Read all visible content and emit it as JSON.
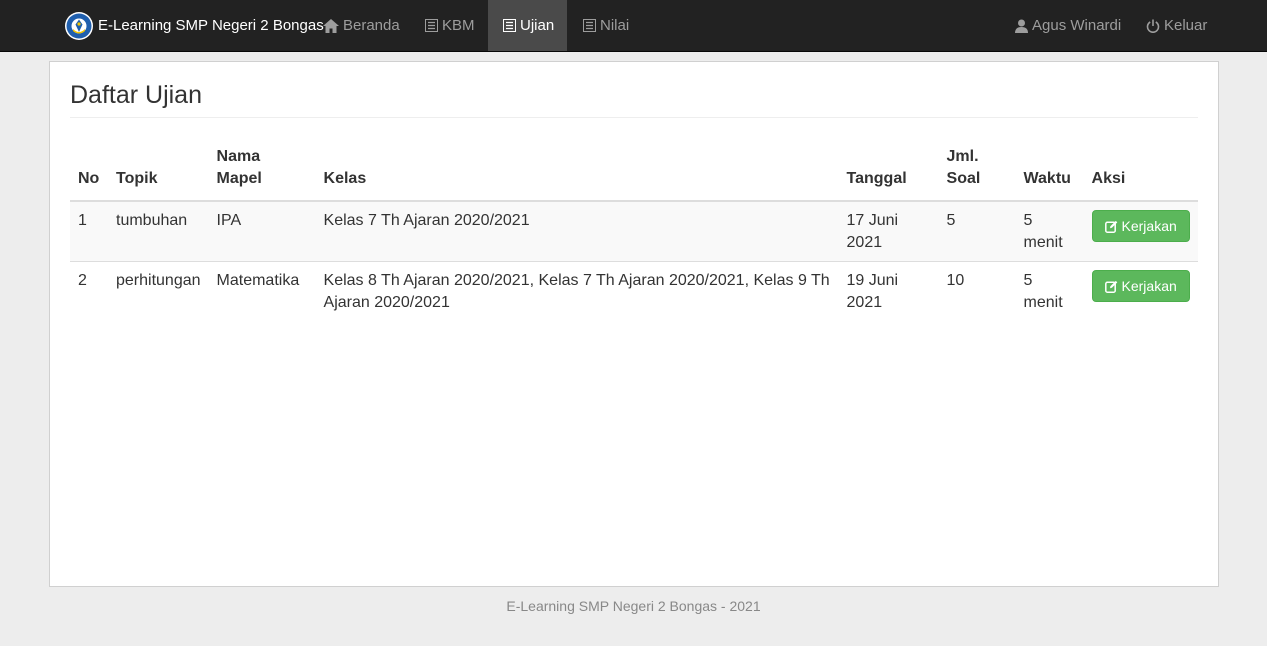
{
  "navbar": {
    "brand": "E-Learning SMP Negeri 2 Bongas",
    "brand_logo_icon": "tut-wuri-handayani-logo",
    "items": [
      {
        "label": "Beranda",
        "icon": "home-icon"
      },
      {
        "label": "KBM",
        "icon": "list-icon"
      },
      {
        "label": "Ujian",
        "icon": "list-icon",
        "active": true
      },
      {
        "label": "Nilai",
        "icon": "list-icon"
      }
    ],
    "user": {
      "label": "Agus Winardi",
      "icon": "user-icon"
    },
    "logout": {
      "label": "Keluar",
      "icon": "power-icon"
    }
  },
  "main": {
    "title": "Daftar Ujian",
    "table": {
      "headers": [
        "No",
        "Topik",
        "Nama Mapel",
        "Kelas",
        "Tanggal",
        "Jml. Soal",
        "Waktu",
        "Aksi"
      ],
      "rows": [
        {
          "no": "1",
          "topik": "tumbuhan",
          "mapel": "IPA",
          "kelas": "Kelas 7 Th Ajaran 2020/2021",
          "tanggal": "17 Juni 2021",
          "jml_soal": "5",
          "waktu": "5 menit",
          "aksi": "Kerjakan"
        },
        {
          "no": "2",
          "topik": "perhitungan",
          "mapel": "Matematika",
          "kelas": "Kelas 8 Th Ajaran 2020/2021, Kelas 7 Th Ajaran 2020/2021, Kelas 9 Th Ajaran 2020/2021",
          "tanggal": "19 Juni 2021",
          "jml_soal": "10",
          "waktu": "5 menit",
          "aksi": "Kerjakan"
        }
      ]
    }
  },
  "footer": {
    "text": "E-Learning SMP Negeri 2 Bongas - 2021"
  },
  "colors": {
    "navbar_bg": "#222222",
    "navbar_active_bg": "#4a4a4a",
    "button_success": "#5cb85c",
    "page_bg": "#ededed"
  }
}
